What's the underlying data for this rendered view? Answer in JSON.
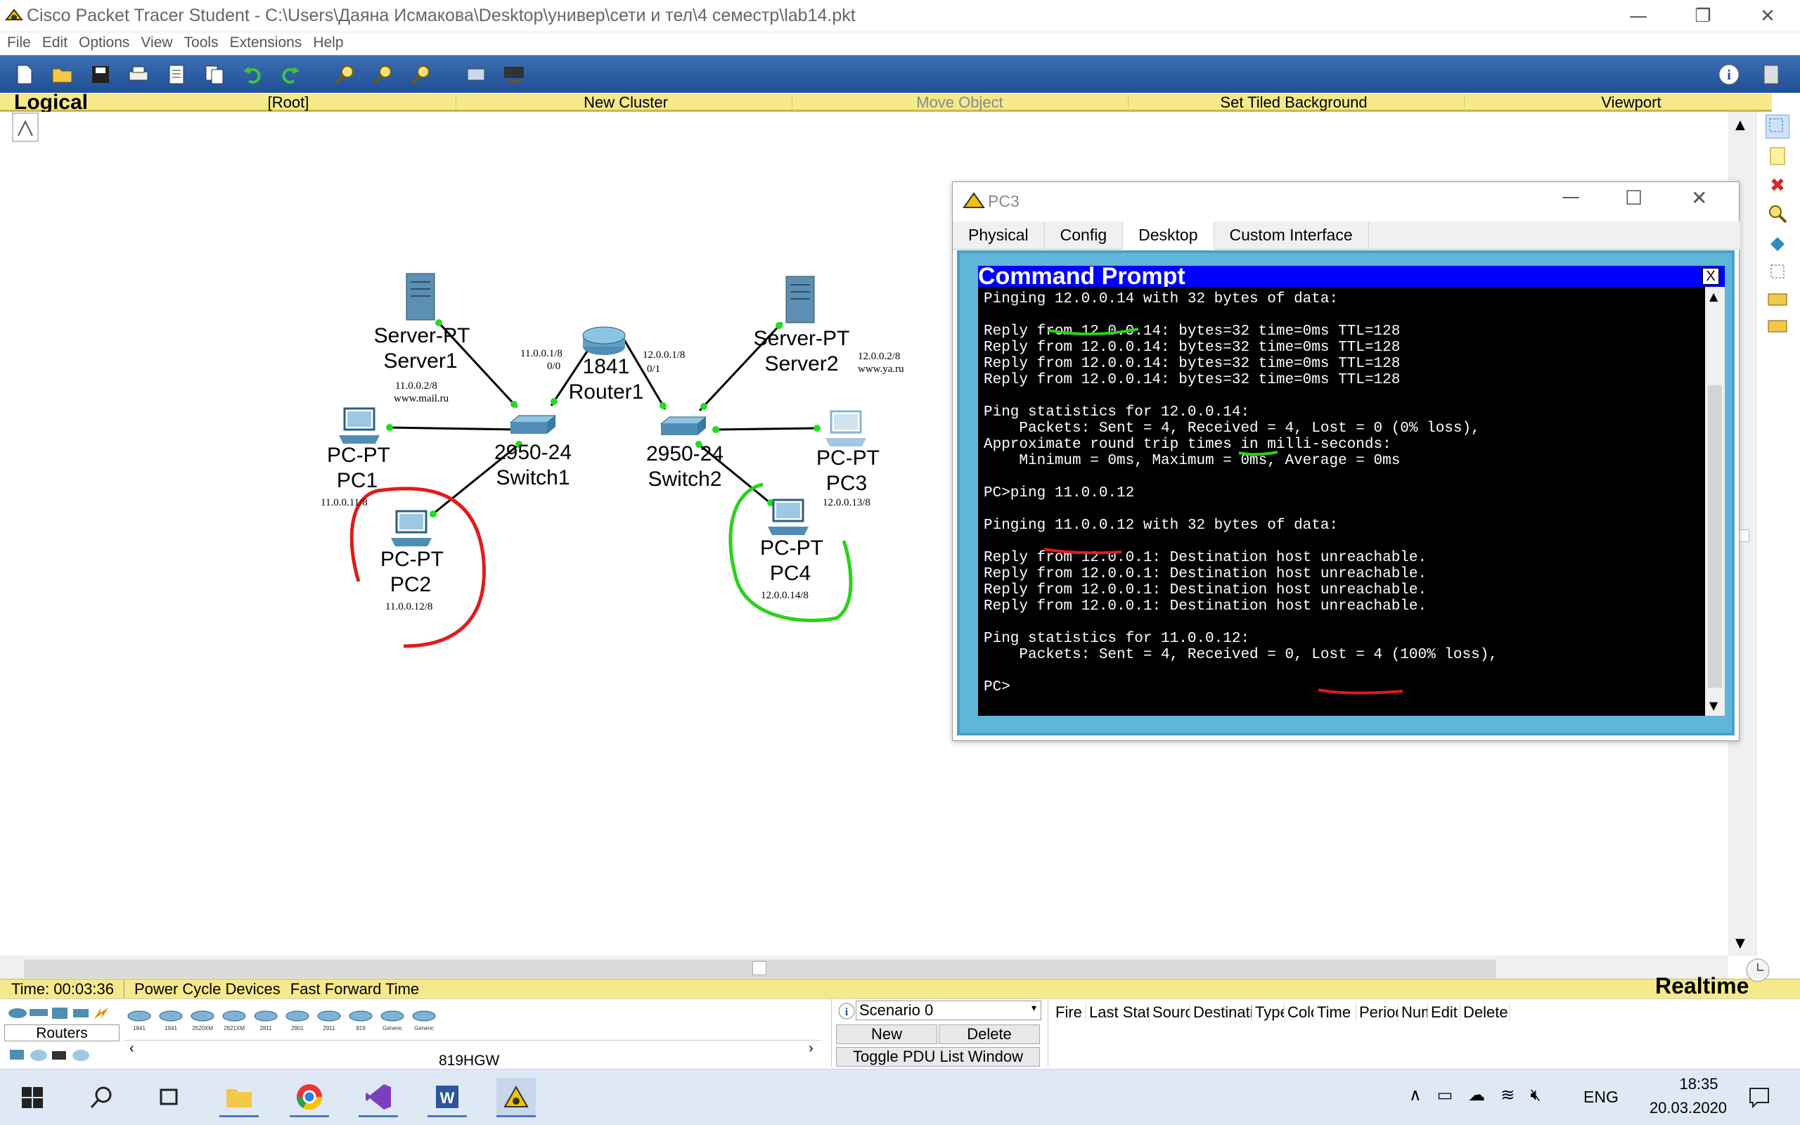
{
  "window": {
    "title": "Cisco Packet Tracer Student - C:\\Users\\Даяна Исмакова\\Desktop\\универ\\сети и тел\\4 семестр\\lab14.pkt",
    "minimize": "—",
    "restore": "❐",
    "close": "✕"
  },
  "menu": [
    "File",
    "Edit",
    "Options",
    "View",
    "Tools",
    "Extensions",
    "Help"
  ],
  "toolbar": {
    "icons": [
      "new-icon",
      "open-icon",
      "save-icon",
      "print-icon",
      "activity-wizard-icon",
      "copy-icon",
      "undo-icon",
      "redo-icon",
      "zoom-in-icon",
      "zoom-reset-icon",
      "zoom-out-icon",
      "palette-icon",
      "custom-device-icon"
    ],
    "info_icon": "info-icon"
  },
  "workspace_bar": {
    "logical": "Logical",
    "root": "[Root]",
    "new_cluster": "New Cluster",
    "move_object": "Move Object",
    "set_tiled_background": "Set Tiled Background",
    "viewport": "Viewport"
  },
  "devices": {
    "server1": {
      "type": "Server-PT",
      "name": "Server1",
      "ip": "11.0.0.2/8",
      "url": "www.mail.ru"
    },
    "server2": {
      "type": "Server-PT",
      "name": "Server2",
      "ip": "12.0.0.2/8",
      "url": "www.ya.ru"
    },
    "router1": {
      "type": "1841",
      "name": "Router1",
      "if0_ip": "11.0.0.1/8",
      "if0": "0/0",
      "if1_ip": "12.0.0.1/8",
      "if1": "0/1"
    },
    "switch1": {
      "type": "2950-24",
      "name": "Switch1"
    },
    "switch2": {
      "type": "2950-24",
      "name": "Switch2"
    },
    "pc1": {
      "type": "PC-PT",
      "name": "PC1",
      "ip": "11.0.0.11/8"
    },
    "pc2": {
      "type": "PC-PT",
      "name": "PC2",
      "ip": "11.0.0.12/8"
    },
    "pc3": {
      "type": "PC-PT",
      "name": "PC3",
      "ip": "12.0.0.13/8"
    },
    "pc4": {
      "type": "PC-PT",
      "name": "PC4",
      "ip": "12.0.0.14/8"
    }
  },
  "annotations": {
    "red_circle_color": "#e11b1b",
    "green_circle_color": "#2bd11b",
    "link_up_color": "#22dd22"
  },
  "pc_window": {
    "title": "PC3",
    "tabs": [
      "Physical",
      "Config",
      "Desktop",
      "Custom Interface"
    ],
    "active_tab": "Desktop",
    "cmd_title": "Command Prompt",
    "cmd_close": "X",
    "lines": [
      "Pinging 12.0.0.14 with 32 bytes of data:",
      "",
      "Reply from 12.0.0.14: bytes=32 time=0ms TTL=128",
      "Reply from 12.0.0.14: bytes=32 time=0ms TTL=128",
      "Reply from 12.0.0.14: bytes=32 time=0ms TTL=128",
      "Reply from 12.0.0.14: bytes=32 time=0ms TTL=128",
      "",
      "Ping statistics for 12.0.0.14:",
      "    Packets: Sent = 4, Received = 4, Lost = 0 (0% loss),",
      "Approximate round trip times in milli-seconds:",
      "    Minimum = 0ms, Maximum = 0ms, Average = 0ms",
      "",
      "PC>ping 11.0.0.12",
      "",
      "Pinging 11.0.0.12 with 32 bytes of data:",
      "",
      "Reply from 12.0.0.1: Destination host unreachable.",
      "Reply from 12.0.0.1: Destination host unreachable.",
      "Reply from 12.0.0.1: Destination host unreachable.",
      "Reply from 12.0.0.1: Destination host unreachable.",
      "",
      "Ping statistics for 11.0.0.12:",
      "    Packets: Sent = 4, Received = 0, Lost = 4 (100% loss),",
      "",
      "PC>"
    ]
  },
  "status": {
    "time": "Time: 00:03:36",
    "power_cycle": "Power Cycle Devices",
    "fast_forward": "Fast Forward Time",
    "realtime": "Realtime"
  },
  "device_panel": {
    "category": "Routers",
    "model_label": "819HGW",
    "models": [
      "1841",
      "1941",
      "2620XM",
      "2621XM",
      "2811",
      "2901",
      "2911",
      "819",
      "Generic",
      "Generic"
    ]
  },
  "scenario": {
    "selected": "Scenario 0",
    "new": "New",
    "delete": "Delete",
    "toggle": "Toggle PDU List Window",
    "columns": [
      "Fire",
      "Last Status",
      "Source",
      "Destination",
      "Type",
      "Color",
      "Time",
      "Periodic",
      "Num",
      "Edit",
      "Delete"
    ]
  },
  "taskbar": {
    "apps": [
      "windows-start-icon",
      "search-icon",
      "task-view-icon",
      "file-explorer-icon",
      "chrome-icon",
      "visual-studio-icon",
      "word-icon",
      "packet-tracer-icon"
    ],
    "lang": "ENG",
    "time": "18:35",
    "date": "20.03.2020"
  }
}
